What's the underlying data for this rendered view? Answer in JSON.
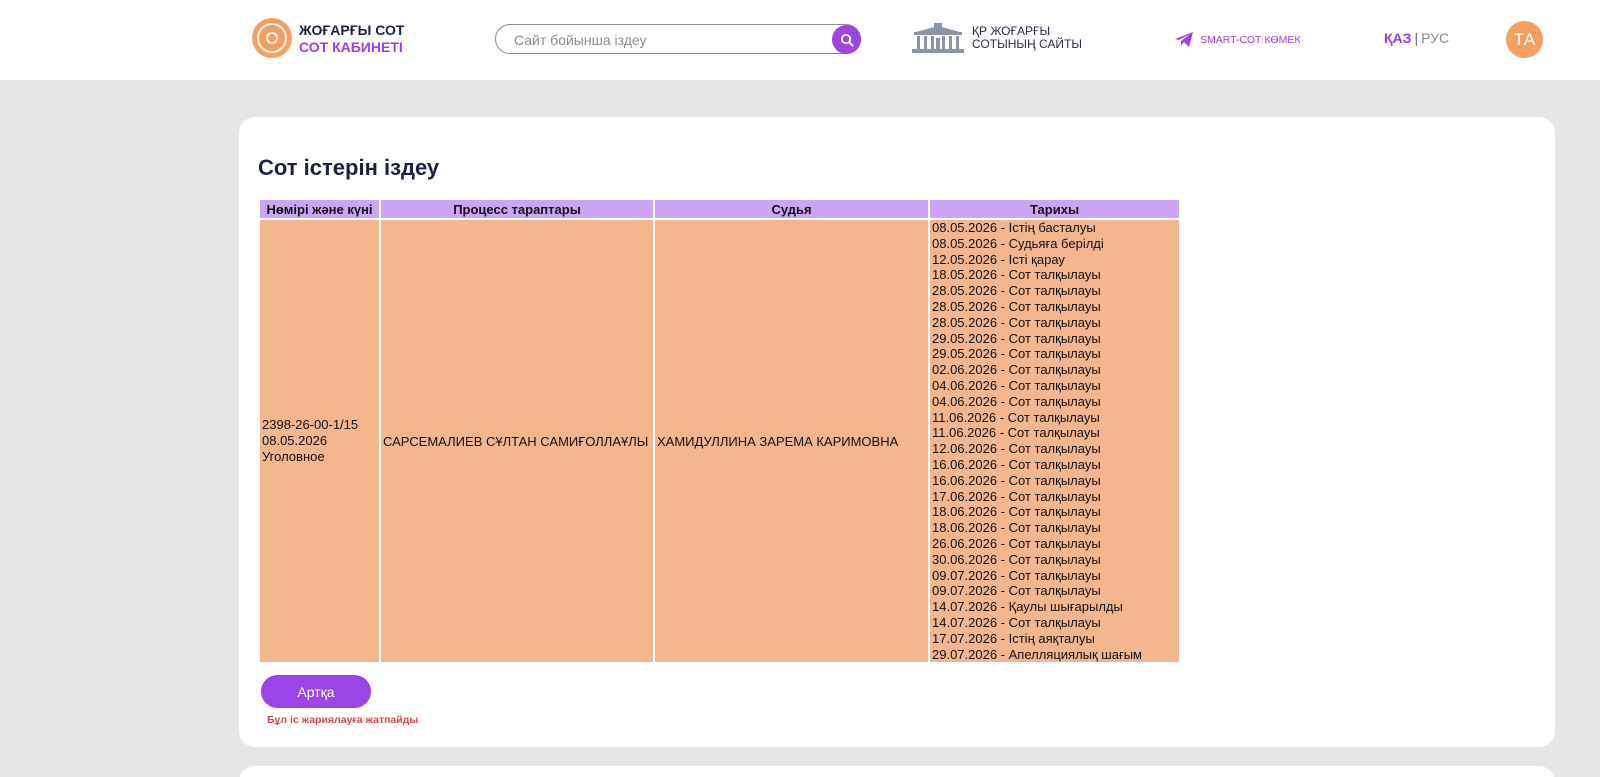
{
  "header": {
    "brand_line1": "ЖОҒАРҒЫ СОТ",
    "brand_line2": "СОТ КАБИНЕТІ",
    "search_placeholder": "Сайт бойынша іздеу",
    "court_site_line1": "ҚР ЖОҒАРҒЫ",
    "court_site_line2": "СОТЫНЫҢ САЙТЫ",
    "help_label": "SMART-СОТ КӨМЕК",
    "lang_active": "ҚАЗ",
    "lang_separator": "|",
    "lang_other": "РУС",
    "avatar_initials": "ТА"
  },
  "colors": {
    "accent": "#9b45e6",
    "orange": "#f4a062",
    "header_cell": "#cba6f5",
    "body_cell": "#f4b68e",
    "note": "#e0464f"
  },
  "main": {
    "title": "Сот істерін іздеу",
    "table": {
      "columns": [
        "Нөмірі және күні",
        "Процесс тараптары",
        "Судья",
        "Тарихы"
      ],
      "case_number": "2398-26-00-1/15",
      "case_date": "08.05.2026",
      "case_type": "Уголовное",
      "parties": "САРСЕМАЛИЕВ СҰЛТАН САМИҒОЛЛАҰЛЫ",
      "judge": "ХАМИДУЛЛИНА ЗАРЕМА КАРИМОВНА",
      "history": [
        "08.05.2026 - Істің басталуы",
        "08.05.2026 - Судьяға берілді",
        "12.05.2026 - Істі қарау",
        "18.05.2026 - Сот талқылауы",
        "28.05.2026 - Сот талқылауы",
        "28.05.2026 - Сот талқылауы",
        "28.05.2026 - Сот талқылауы",
        "29.05.2026 - Сот талқылауы",
        "29.05.2026 - Сот талқылауы",
        "02.06.2026 - Сот талқылауы",
        "04.06.2026 - Сот талқылауы",
        "04.06.2026 - Сот талқылауы",
        "11.06.2026 - Сот талқылауы",
        "11.06.2026 - Сот талқылауы",
        "12.06.2026 - Сот талқылауы",
        "16.06.2026 - Сот талқылауы",
        "16.06.2026 - Сот талқылауы",
        "17.06.2026 - Сот талқылауы",
        "18.06.2026 - Сот талқылауы",
        "18.06.2026 - Сот талқылауы",
        "26.06.2026 - Сот талқылауы",
        "30.06.2026 - Сот талқылауы",
        "09.07.2026 - Сот талқылауы",
        "09.07.2026 - Сот талқылауы",
        "14.07.2026 - Қаулы шығарылды",
        "14.07.2026 - Сот талқылауы",
        "17.07.2026 - Істің аяқталуы",
        "29.07.2026 - Апелляциялық шағым"
      ]
    },
    "back_label": "Артқа",
    "note": "Бұл іс жариялауға жатпайды"
  },
  "icons": {
    "logo": "court-emblem-icon",
    "search": "search-icon",
    "court_site": "court-building-icon",
    "help": "telegram-icon"
  }
}
